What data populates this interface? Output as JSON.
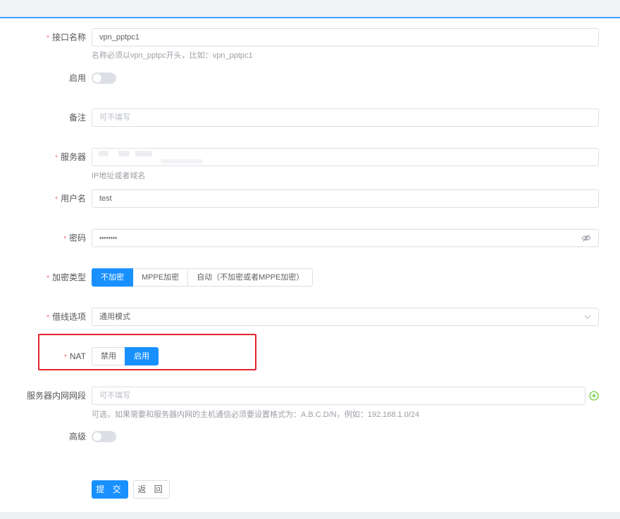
{
  "form": {
    "iface": {
      "label": "接口名称",
      "value": "vpn_pptpc1",
      "hint": "名称必须以vpn_pptpc开头，比如：vpn_pptpc1"
    },
    "enable": {
      "label": "启用",
      "checked": false
    },
    "remark": {
      "label": "备注",
      "placeholder": "可不填写"
    },
    "server": {
      "label": "服务器",
      "value": "",
      "hint": "IP地址或者域名"
    },
    "username": {
      "label": "用户名",
      "value": "test"
    },
    "password": {
      "label": "密码",
      "value": "••••••••"
    },
    "encrypt": {
      "label": "加密类型",
      "options": [
        "不加密",
        "MPPE加密",
        "自动（不加密或者MPPE加密）"
      ],
      "selected": "不加密"
    },
    "line": {
      "label": "借线选项",
      "value": "通用模式"
    },
    "nat": {
      "label": "NAT",
      "options": [
        "禁用",
        "启用"
      ],
      "selected": "启用"
    },
    "subnet": {
      "label": "服务器内网网段",
      "placeholder": "可不填写",
      "hint": "可选，如果需要和服务器内网的主机通信必须要设置格式为：A.B.C.D/N，例如：192.168.1.0/24"
    },
    "advanced": {
      "label": "高级",
      "checked": false
    }
  },
  "actions": {
    "submit": "提 交",
    "back": "返 回"
  },
  "required_mark": "*",
  "colors": {
    "primary": "#1890ff",
    "required": "#f56c6c",
    "highlight_box": "#e3242b",
    "add_icon": "#52c41a"
  },
  "icons": {
    "password_toggle": "eye-slash-icon",
    "select_arrow": "chevron-down-icon",
    "add": "plus-circle-icon"
  }
}
